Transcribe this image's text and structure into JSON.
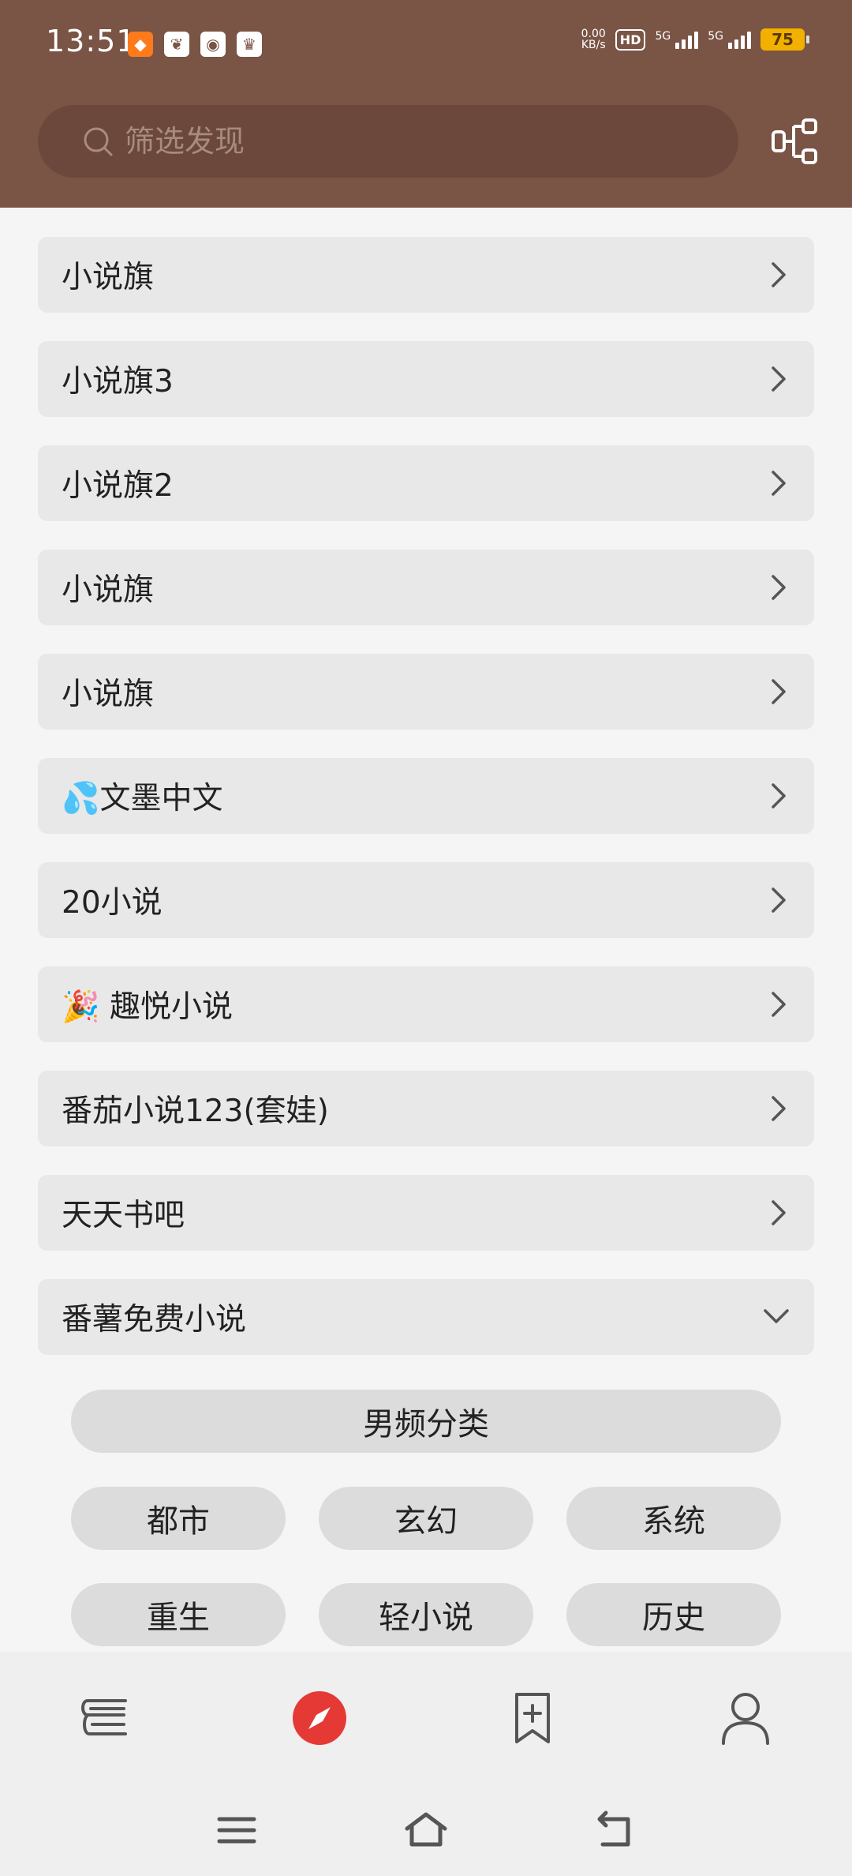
{
  "status_bar": {
    "time": "13:51",
    "net_speed_value": "0.00",
    "net_speed_unit": "KB/s",
    "hd_label": "HD",
    "signal1_label": "5G",
    "signal2_label": "5G",
    "battery": "75"
  },
  "search": {
    "placeholder": "筛选发现"
  },
  "sources": [
    {
      "label": "小说旗"
    },
    {
      "label": "小说旗3"
    },
    {
      "label": "小说旗2"
    },
    {
      "label": "小说旗"
    },
    {
      "label": "小说旗"
    },
    {
      "label": "💦文墨中文"
    },
    {
      "label": "20小说"
    },
    {
      "label": "🎉 趣悦小说"
    },
    {
      "label": "番茄小说123(套娃)"
    },
    {
      "label": "天天书吧"
    },
    {
      "label": "番薯免费小说"
    }
  ],
  "categories": {
    "header": "男频分类",
    "items": [
      "都市",
      "玄幻",
      "系统",
      "重生",
      "轻小说",
      "历史"
    ]
  },
  "bottom_nav": {
    "items": [
      {
        "icon": "bookshelf-icon"
      },
      {
        "icon": "compass-icon",
        "active": true
      },
      {
        "icon": "bookmark-add-icon"
      },
      {
        "icon": "profile-icon"
      }
    ],
    "active_color": "#e53935"
  },
  "colors": {
    "header": "#7a5445",
    "row": "#e8e8e8",
    "chip": "#dcdcdc"
  }
}
